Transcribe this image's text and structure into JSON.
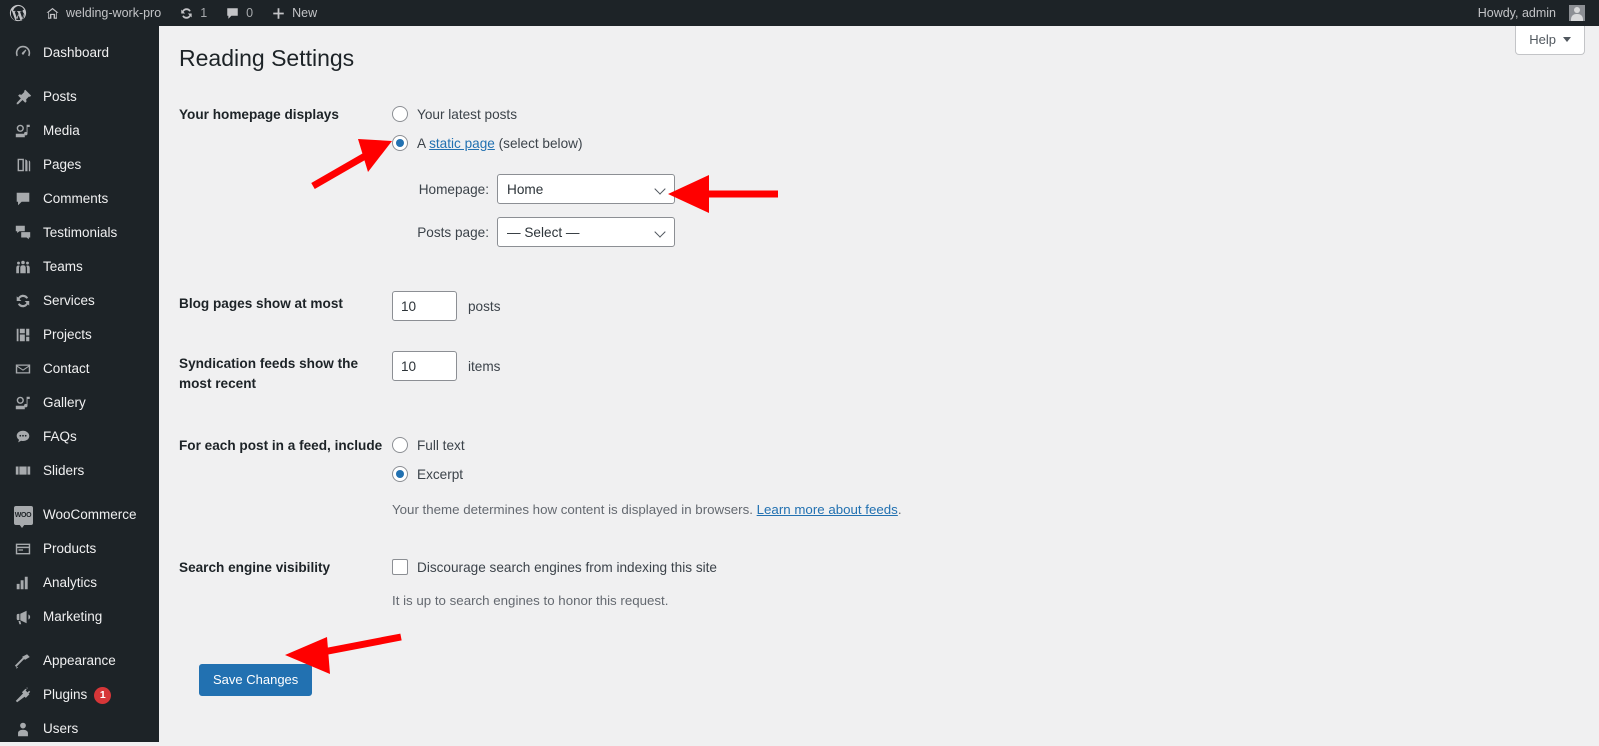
{
  "adminbar": {
    "site_name": "welding-work-pro",
    "updates_count": "1",
    "comments_count": "0",
    "new_label": "New",
    "howdy": "Howdy, admin",
    "wp_logo_icon": "wordpress-logo-icon",
    "home_icon": "home-icon",
    "updates_icon": "updates-icon",
    "comments_icon": "comment-bubble-icon",
    "new_icon": "plus-icon",
    "avatar_icon": "avatar-icon"
  },
  "sidebar": {
    "items": [
      {
        "label": "Dashboard",
        "icon": "dashboard-icon",
        "sep_after": true
      },
      {
        "label": "Posts",
        "icon": "pin-icon"
      },
      {
        "label": "Media",
        "icon": "media-icon"
      },
      {
        "label": "Pages",
        "icon": "pages-icon"
      },
      {
        "label": "Comments",
        "icon": "comment-bubble-icon"
      },
      {
        "label": "Testimonials",
        "icon": "testimonials-icon"
      },
      {
        "label": "Teams",
        "icon": "teams-icon"
      },
      {
        "label": "Services",
        "icon": "services-icon"
      },
      {
        "label": "Projects",
        "icon": "projects-icon"
      },
      {
        "label": "Contact",
        "icon": "envelope-icon"
      },
      {
        "label": "Gallery",
        "icon": "gallery-icon"
      },
      {
        "label": "FAQs",
        "icon": "faq-icon"
      },
      {
        "label": "Sliders",
        "icon": "sliders-icon",
        "sep_after": true
      },
      {
        "label": "WooCommerce",
        "icon": "woocommerce-icon"
      },
      {
        "label": "Products",
        "icon": "products-icon"
      },
      {
        "label": "Analytics",
        "icon": "analytics-icon"
      },
      {
        "label": "Marketing",
        "icon": "marketing-icon",
        "sep_after": true
      },
      {
        "label": "Appearance",
        "icon": "appearance-icon"
      },
      {
        "label": "Plugins",
        "icon": "plugins-icon",
        "badge": "1"
      },
      {
        "label": "Users",
        "icon": "users-icon"
      }
    ]
  },
  "content": {
    "help_label": "Help",
    "page_title": "Reading Settings"
  },
  "form": {
    "homepage_displays": {
      "label": "Your homepage displays",
      "option_latest": "Your latest posts",
      "option_static_prefix": "A ",
      "option_static_link": "static page",
      "option_static_suffix": " (select below)",
      "selected": "static",
      "homepage_label": "Homepage:",
      "homepage_value": "Home",
      "homepage_options": [
        "Home",
        "— Select —"
      ],
      "posts_page_label": "Posts page:",
      "posts_page_value": "— Select —",
      "posts_page_options": [
        "— Select —",
        "Home"
      ]
    },
    "blog_pages": {
      "label": "Blog pages show at most",
      "value": "10",
      "unit": "posts"
    },
    "syndication": {
      "label": "Syndication feeds show the most recent",
      "value": "10",
      "unit": "items"
    },
    "feed_include": {
      "label": "For each post in a feed, include",
      "option_full": "Full text",
      "option_excerpt": "Excerpt",
      "selected": "excerpt",
      "description_prefix": "Your theme determines how content is displayed in browsers. ",
      "description_link": "Learn more about feeds",
      "description_suffix": "."
    },
    "search_visibility": {
      "label": "Search engine visibility",
      "checkbox_label": "Discourage search engines from indexing this site",
      "checked": false,
      "description": "It is up to search engines to honor this request."
    },
    "save_label": "Save Changes"
  },
  "annotations": {
    "arrow_color": "#FF0000",
    "arrows": [
      {
        "name": "arrow-to-static-page-radio",
        "points_to": "static page radio button"
      },
      {
        "name": "arrow-to-homepage-select",
        "points_to": "Homepage dropdown"
      },
      {
        "name": "arrow-to-save-changes",
        "points_to": "Save Changes button"
      }
    ]
  },
  "colors": {
    "admin_bar_bg": "#1d2327",
    "sidebar_bg": "#1d2327",
    "content_bg": "#f0f0f1",
    "accent_blue": "#2271b1",
    "badge_red": "#d63638",
    "annotation_red": "#FF0000"
  }
}
